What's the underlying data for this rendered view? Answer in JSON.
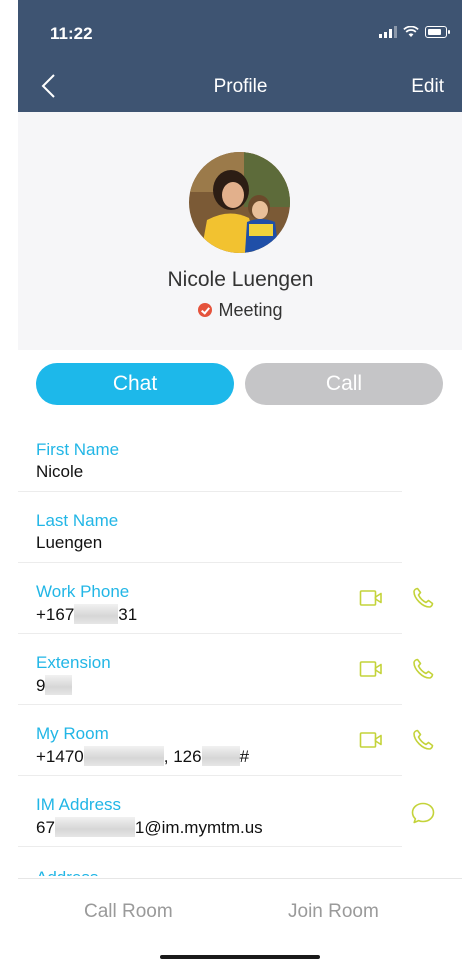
{
  "status_bar": {
    "time": "11:22"
  },
  "nav": {
    "title": "Profile",
    "edit_label": "Edit"
  },
  "profile": {
    "name": "Nicole Luengen",
    "presence": "Meeting"
  },
  "actions": {
    "chat_label": "Chat",
    "call_label": "Call"
  },
  "fields": {
    "first_name": {
      "label": "First Name",
      "value": "Nicole"
    },
    "last_name": {
      "label": "Last Name",
      "value": "Luengen"
    },
    "work_phone": {
      "label": "Work Phone",
      "value_start": "+167",
      "value_end": "31"
    },
    "extension": {
      "label": "Extension",
      "value_start": "9"
    },
    "my_room": {
      "label": "My Room",
      "value_start": "+1470",
      "value_mid": ", 126",
      "value_end": "#"
    },
    "im_address": {
      "label": "IM Address",
      "value_start": "67",
      "value_end": "1@im.mymtm.us"
    },
    "address_label_partial": "Address"
  },
  "bottom": {
    "call_room_label": "Call Room",
    "join_room_label": "Join Room"
  },
  "colors": {
    "nav_bar": "#3e5472",
    "accent_blue": "#1db8ea",
    "action_green": "#c4d33a",
    "presence_red": "#e5533c"
  }
}
